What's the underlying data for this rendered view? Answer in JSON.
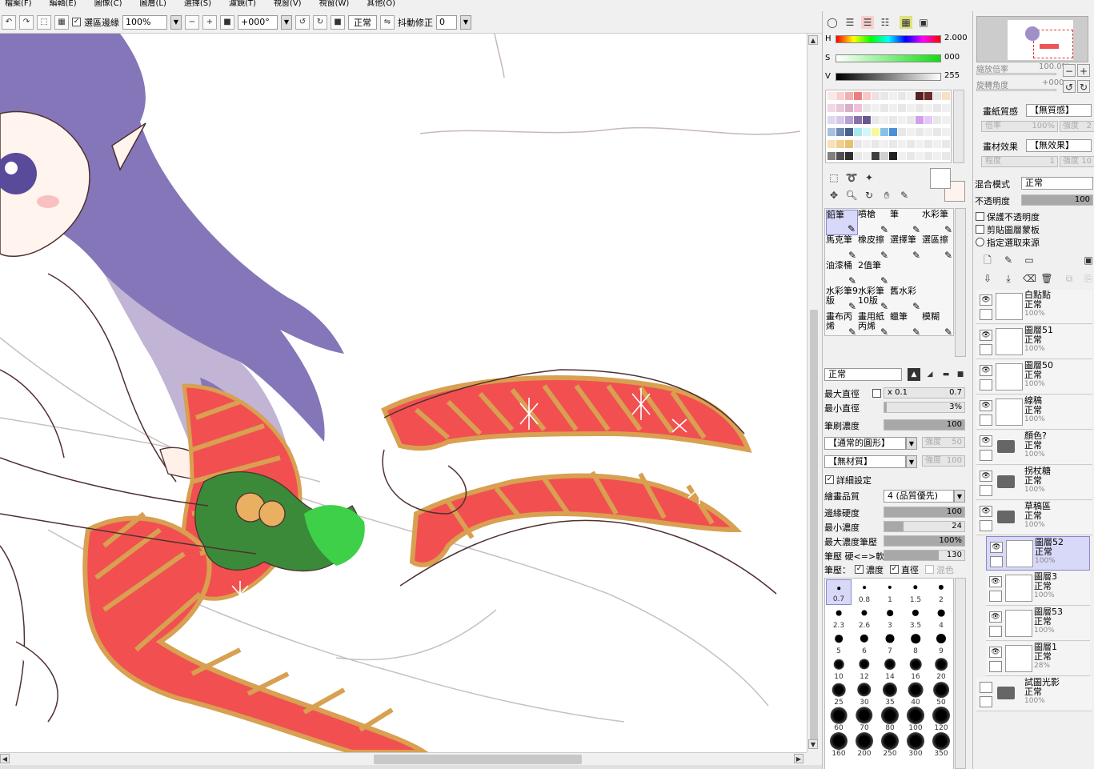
{
  "menu": [
    "檔案(F)",
    "編輯(E)",
    "圖像(C)",
    "圖層(L)",
    "選擇(S)",
    "濾鏡(T)",
    "視窗(V)",
    "視窗(W)",
    "其他(O)"
  ],
  "toolbar": {
    "selection_edge_label": "選區邊緣",
    "selection_edge_checked": true,
    "zoom": "100%",
    "rotation": "+000°",
    "blend": "正常",
    "stabilizer_label": "抖動修正",
    "stabilizer_value": "0"
  },
  "color": {
    "h_label": "H",
    "h_value": "2.000",
    "s_label": "S",
    "s_value": "000",
    "v_label": "V",
    "v_value": "255",
    "primary": "#ffffff",
    "secondary": "#fff3ee"
  },
  "tools": [
    {
      "label": "鉛筆"
    },
    {
      "label": "噴槍"
    },
    {
      "label": "筆"
    },
    {
      "label": "水彩筆"
    },
    {
      "label": "馬克筆"
    },
    {
      "label": "橡皮擦"
    },
    {
      "label": "選擇筆"
    },
    {
      "label": "選區擦"
    },
    {
      "label": "油漆桶"
    },
    {
      "label": "2值筆"
    },
    {
      "label": ""
    },
    {
      "label": ""
    },
    {
      "label": "水彩筆9版"
    },
    {
      "label": "水彩筆10版"
    },
    {
      "label": "舊水彩"
    },
    {
      "label": ""
    },
    {
      "label": "畫布丙烯"
    },
    {
      "label": "畫用紙丙烯"
    },
    {
      "label": "蠟筆"
    },
    {
      "label": "模糊"
    }
  ],
  "brush": {
    "mode": "正常",
    "max_size_label": "最大直徑",
    "max_size_mult": "x 0.1",
    "max_size_value": "0.7",
    "min_size_label": "最小直徑",
    "min_size_value": "3%",
    "density_label": "筆刷濃度",
    "density_value": "100",
    "shape": "【通常的圓形】",
    "shape_strength_label": "強度",
    "shape_strength": "50",
    "texture": "【無材質】",
    "texture_strength_label": "強度",
    "texture_strength": "100",
    "advanced_label": "詳細設定",
    "quality_label": "繪畫品質",
    "quality_value": "4 (品質優先)",
    "edge_hardness_label": "邊緣硬度",
    "edge_hardness_value": "100",
    "min_density_label": "最小濃度",
    "min_density_value": "24",
    "max_pressure_label": "最大濃度筆壓",
    "max_pressure_value": "100%",
    "pressure_label": "筆壓 硬<=>軟",
    "pressure_value": "130",
    "pressure_opts_label": "筆壓：",
    "opt_density": "濃度",
    "opt_size": "直徑",
    "opt_blend": "混色"
  },
  "brush_sizes": [
    "0.7",
    "0.8",
    "1",
    "1.5",
    "2",
    "2.3",
    "2.6",
    "3",
    "3.5",
    "4",
    "5",
    "6",
    "7",
    "8",
    "9",
    "10",
    "12",
    "14",
    "16",
    "20",
    "25",
    "30",
    "35",
    "40",
    "50",
    "60",
    "70",
    "80",
    "100",
    "120",
    "160",
    "200",
    "250",
    "300",
    "350"
  ],
  "navigator": {
    "zoom_label": "縮放倍率",
    "zoom_value": "100.0%",
    "angle_label": "旋轉角度",
    "angle_value": "+000"
  },
  "paper": {
    "texture_label": "畫紙質感",
    "texture_value": "【無質感】",
    "scale_label": "倍率",
    "scale_value": "100%",
    "strength_label": "強度",
    "strength_value": "2",
    "effect_label": "畫材效果",
    "effect_value": "【無效果】",
    "degree_label": "程度",
    "degree_value": "1",
    "strength2_label": "強度",
    "strength2_value": "10"
  },
  "layer_props": {
    "blend_label": "混合模式",
    "blend_value": "正常",
    "opacity_label": "不透明度",
    "opacity_value": "100",
    "protect_label": "保護不透明度",
    "clip_label": "剪貼圖層蒙板",
    "selection_source_label": "指定選取來源"
  },
  "layers": [
    {
      "name": "白點點",
      "mode": "正常",
      "opacity": "100%",
      "folder": false,
      "indent": false,
      "selected": false
    },
    {
      "name": "圖層51",
      "mode": "正常",
      "opacity": "100%",
      "folder": false,
      "indent": false,
      "selected": false
    },
    {
      "name": "圖層50",
      "mode": "正常",
      "opacity": "100%",
      "folder": false,
      "indent": false,
      "selected": false
    },
    {
      "name": "線稿",
      "mode": "正常",
      "opacity": "100%",
      "folder": false,
      "indent": false,
      "selected": false
    },
    {
      "name": "顏色?",
      "mode": "正常",
      "opacity": "100%",
      "folder": true,
      "indent": false,
      "selected": false
    },
    {
      "name": "拐杖糖",
      "mode": "正常",
      "opacity": "100%",
      "folder": true,
      "indent": false,
      "selected": false
    },
    {
      "name": "草稿區",
      "mode": "正常",
      "opacity": "100%",
      "folder": true,
      "indent": false,
      "selected": false
    },
    {
      "name": "圖層52",
      "mode": "正常",
      "opacity": "100%",
      "folder": false,
      "indent": true,
      "selected": true
    },
    {
      "name": "圖層3",
      "mode": "正常",
      "opacity": "100%",
      "folder": false,
      "indent": true,
      "selected": false
    },
    {
      "name": "圖層53",
      "mode": "正常",
      "opacity": "100%",
      "folder": false,
      "indent": true,
      "selected": false
    },
    {
      "name": "圖層1",
      "mode": "正常",
      "opacity": "28%",
      "folder": false,
      "indent": true,
      "selected": false
    },
    {
      "name": "試圖光影",
      "mode": "正常",
      "opacity": "100%",
      "folder": true,
      "indent": false,
      "selected": false
    }
  ]
}
